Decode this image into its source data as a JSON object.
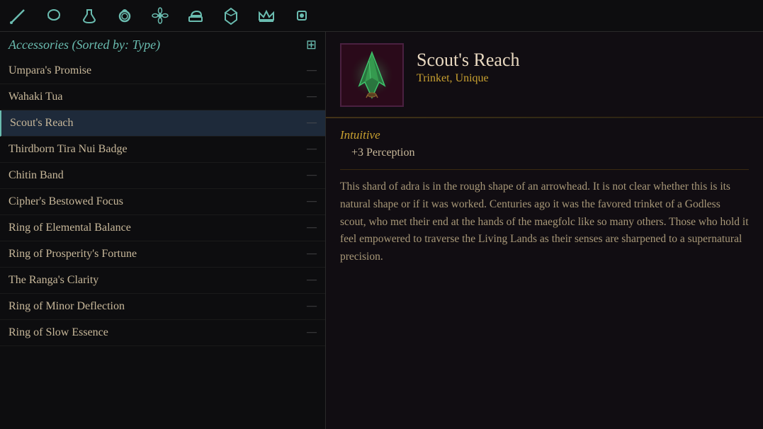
{
  "topbar": {
    "icons": [
      {
        "name": "sword-icon",
        "symbol": "⚔",
        "active": true
      },
      {
        "name": "helmet-icon",
        "symbol": "🪖",
        "active": false
      },
      {
        "name": "potion-icon",
        "symbol": "⚗",
        "active": false
      },
      {
        "name": "ring-icon",
        "symbol": "💍",
        "active": true
      },
      {
        "name": "flower-icon",
        "symbol": "✦",
        "active": false
      },
      {
        "name": "anvil-icon",
        "symbol": "⚒",
        "active": false
      },
      {
        "name": "gem-icon",
        "symbol": "💎",
        "active": false
      },
      {
        "name": "crown-icon",
        "symbol": "👑",
        "active": false
      },
      {
        "name": "shield-icon",
        "symbol": "🛡",
        "active": false
      }
    ]
  },
  "leftPanel": {
    "title": "Accessories (Sorted by: Type)",
    "sortIconLabel": "⊞",
    "items": [
      {
        "name": "Umpara's Promise",
        "value": "—",
        "selected": false
      },
      {
        "name": "Wahaki Tua",
        "value": "—",
        "selected": false
      },
      {
        "name": "Scout's Reach",
        "value": "—",
        "selected": true
      },
      {
        "name": "Thirdborn Tira Nui Badge",
        "value": "—",
        "selected": false
      },
      {
        "name": "Chitin Band",
        "value": "—",
        "selected": false
      },
      {
        "name": "Cipher's Bestowed Focus",
        "value": "—",
        "selected": false
      },
      {
        "name": "Ring of Elemental Balance",
        "value": "—",
        "selected": false
      },
      {
        "name": "Ring of Prosperity's Fortune",
        "value": "—",
        "selected": false
      },
      {
        "name": "The Ranga's Clarity",
        "value": "—",
        "selected": false
      },
      {
        "name": "Ring of Minor Deflection",
        "value": "—",
        "selected": false
      },
      {
        "name": "Ring of Slow Essence",
        "value": "—",
        "selected": false
      }
    ]
  },
  "rightPanel": {
    "item": {
      "name": "Scout's Reach",
      "type": "Trinket, Unique",
      "propertyLabel": "Intuitive",
      "propertyValue": "+3 Perception",
      "description": "This shard of adra is in the rough shape of an arrowhead. It is not clear whether this is its natural shape or if it was worked. Centuries ago it was the favored trinket of a Godless scout, who met their end at the hands of the maegfolc like so many others. Those who hold it feel empowered to traverse the Living Lands as their senses are sharpened to a supernatural precision."
    }
  }
}
